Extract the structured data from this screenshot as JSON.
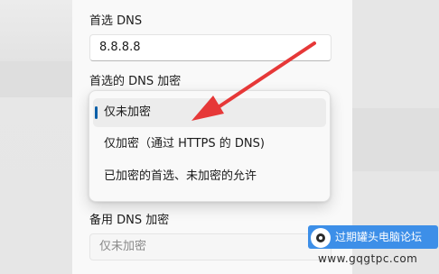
{
  "dns": {
    "preferred_label": "首选 DNS",
    "preferred_value": "8.8.8.8",
    "preferred_encryption_label": "首选的 DNS 加密",
    "alternate_encryption_label": "备用 DNS 加密",
    "alternate_encryption_value": "仅未加密"
  },
  "dropdown": {
    "options": [
      {
        "label": "仅未加密",
        "selected": true
      },
      {
        "label": "仅加密（通过 HTTPS 的 DNS)",
        "selected": false
      },
      {
        "label": "已加密的首选、未加密的允许",
        "selected": false
      }
    ]
  },
  "annotation": {
    "arrow_color": "#e63838"
  },
  "watermark": {
    "title": "过期罐头电脑论坛",
    "url": "www.gqgtpc.com",
    "badge_color": "#3d8fe8"
  },
  "colors": {
    "accent": "#0c5fa8"
  }
}
